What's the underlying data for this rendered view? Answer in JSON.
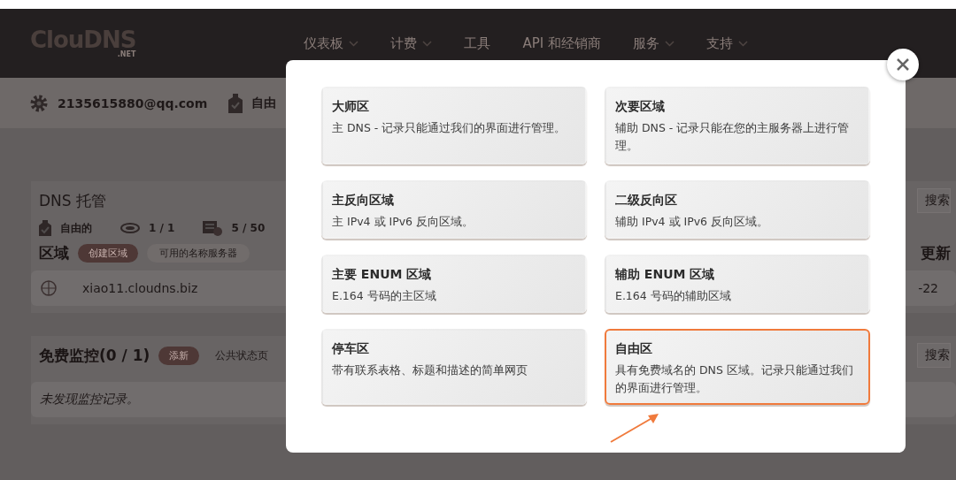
{
  "header": {
    "logo": "ClouDNS",
    "logo_sub": ".NET",
    "nav": [
      {
        "label": "仪表板",
        "dropdown": true
      },
      {
        "label": "计费",
        "dropdown": true
      },
      {
        "label": "工具",
        "dropdown": false
      },
      {
        "label": "API 和经销商",
        "dropdown": false
      },
      {
        "label": "服务",
        "dropdown": true
      },
      {
        "label": "支持",
        "dropdown": true
      }
    ]
  },
  "account_bar": {
    "email": "2135615880@qq.com",
    "plan": "自由"
  },
  "dns_hosting": {
    "title": "DNS 托管",
    "search": "搜索",
    "stats": [
      {
        "kind": "plan",
        "value": "自由的"
      },
      {
        "kind": "zones",
        "value": "1 / 1"
      },
      {
        "kind": "records",
        "value": "5 / 50"
      }
    ],
    "zones_label": "区域",
    "buttons": [
      "创建区域",
      "可用的名称服务器"
    ],
    "column_update": "更新",
    "zones": [
      {
        "name": "xiao11.cloudns.biz",
        "date": "-22"
      }
    ]
  },
  "monitoring": {
    "title": "免费监控(0 / 1)",
    "add_button": "添新",
    "status_page": "公共状态页",
    "search": "搜索",
    "empty": "未发现监控记录。"
  },
  "modal": {
    "options": [
      {
        "title": "大师区",
        "description": "主 DNS - 记录只能通过我们的界面进行管理。",
        "selected": false
      },
      {
        "title": "次要区域",
        "description": "辅助 DNS - 记录只能在您的主服务器上进行管理。",
        "selected": false
      },
      {
        "title": "主反向区域",
        "description": "主 IPv4 或 IPv6 反向区域。",
        "selected": false
      },
      {
        "title": "二级反向区",
        "description": "辅助 IPv4 或 IPv6 反向区域。",
        "selected": false
      },
      {
        "title": "主要 ENUM 区域",
        "description": "E.164 号码的主区域",
        "selected": false
      },
      {
        "title": "辅助 ENUM 区域",
        "description": "E.164 号码的辅助区域",
        "selected": false
      },
      {
        "title": "停车区",
        "description": "带有联系表格、标题和描述的简单网页",
        "selected": false
      },
      {
        "title": "自由区",
        "description": "具有免费域名的 DNS 区域。记录只能通过我们的界面进行管理。",
        "selected": true
      }
    ]
  }
}
